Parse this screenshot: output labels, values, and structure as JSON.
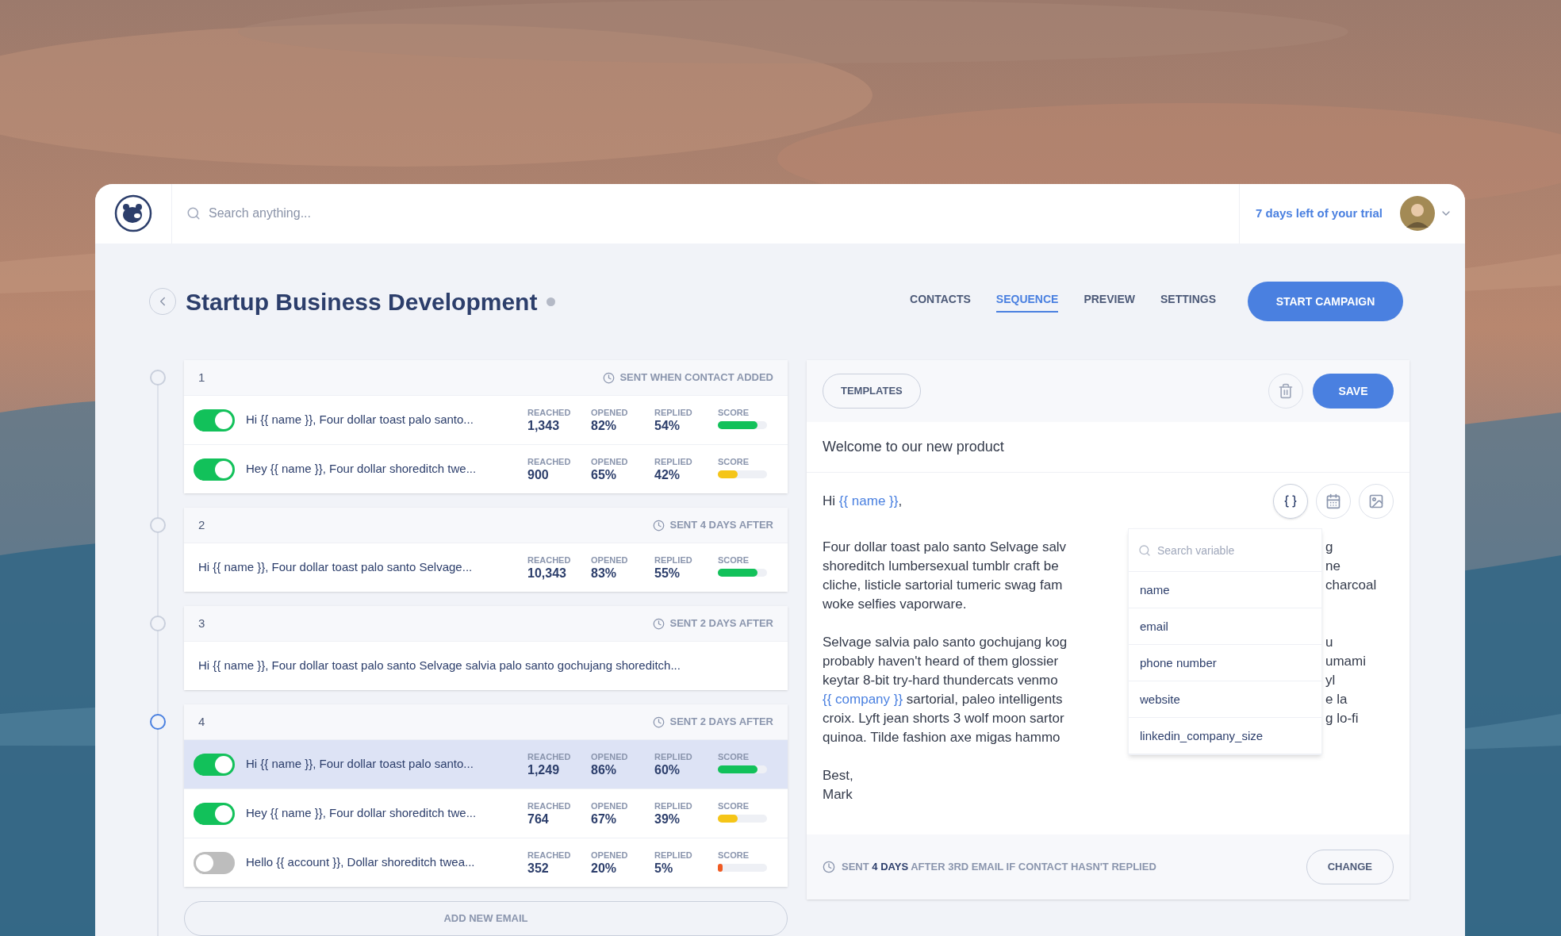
{
  "topbar": {
    "search_placeholder": "Search anything...",
    "trial": "7 days left of your trial"
  },
  "campaign": {
    "title": "Startup Business Development",
    "tabs": [
      {
        "label": "CONTACTS",
        "selected": false
      },
      {
        "label": "SEQUENCE",
        "selected": true
      },
      {
        "label": "PREVIEW",
        "selected": false
      },
      {
        "label": "SETTINGS",
        "selected": false
      }
    ],
    "start_button": "START CAMPAIGN"
  },
  "steps": [
    {
      "number": "1",
      "schedule": "SENT WHEN CONTACT ADDED",
      "selected": false,
      "emails": [
        {
          "kind": "toggle",
          "on": true,
          "selected": false,
          "preview": "Hi {{ name }}, Four dollar toast palo santo...",
          "stats": [
            {
              "label": "REACHED",
              "value": "1,343"
            },
            {
              "label": "OPENED",
              "value": "82%"
            },
            {
              "label": "REPLIED",
              "value": "54%"
            }
          ],
          "score_label": "SCORE",
          "level": 0.8,
          "color": "#12c15a"
        },
        {
          "kind": "toggle",
          "on": true,
          "selected": false,
          "preview": "Hey {{ name }}, Four dollar shoreditch twe...",
          "stats": [
            {
              "label": "REACHED",
              "value": "900"
            },
            {
              "label": "OPENED",
              "value": "65%"
            },
            {
              "label": "REPLIED",
              "value": "42%"
            }
          ],
          "score_label": "SCORE",
          "level": 0.4,
          "color": "#f5c518"
        }
      ]
    },
    {
      "number": "2",
      "schedule": "SENT 4 DAYS AFTER",
      "selected": false,
      "emails": [
        {
          "kind": "plain",
          "selected": false,
          "preview": "Hi {{ name }}, Four dollar toast  palo santo  Selvage...",
          "stats": [
            {
              "label": "REACHED",
              "value": "10,343"
            },
            {
              "label": "OPENED",
              "value": "83%"
            },
            {
              "label": "REPLIED",
              "value": "55%"
            }
          ],
          "score_label": "SCORE",
          "level": 0.8,
          "color": "#12c15a"
        }
      ]
    },
    {
      "number": "3",
      "schedule": "SENT 2 DAYS AFTER",
      "selected": false,
      "emails": [
        {
          "kind": "text",
          "selected": false,
          "preview": "Hi {{ name }}, Four dollar toast  palo santo  Selvage salvia palo santo gochujang shoreditch..."
        }
      ]
    },
    {
      "number": "4",
      "schedule": "SENT 2 DAYS AFTER",
      "selected": true,
      "emails": [
        {
          "kind": "toggle",
          "on": true,
          "selected": true,
          "preview": "Hi {{ name }}, Four dollar toast  palo santo...",
          "stats": [
            {
              "label": "REACHED",
              "value": "1,249"
            },
            {
              "label": "OPENED",
              "value": "86%"
            },
            {
              "label": "REPLIED",
              "value": "60%"
            }
          ],
          "score_label": "SCORE",
          "level": 0.8,
          "color": "#12c15a"
        },
        {
          "kind": "toggle",
          "on": true,
          "selected": false,
          "preview": "Hey {{ name }}, Four dollar shoreditch twe...",
          "stats": [
            {
              "label": "REACHED",
              "value": "764"
            },
            {
              "label": "OPENED",
              "value": "67%"
            },
            {
              "label": "REPLIED",
              "value": "39%"
            }
          ],
          "score_label": "SCORE",
          "level": 0.4,
          "color": "#f5c518"
        },
        {
          "kind": "toggle",
          "on": false,
          "selected": false,
          "preview": "Hello {{ account }}, Dollar shoreditch twea...",
          "stats": [
            {
              "label": "REACHED",
              "value": "352"
            },
            {
              "label": "OPENED",
              "value": "20%"
            },
            {
              "label": "REPLIED",
              "value": "5%"
            }
          ],
          "score_label": "SCORE",
          "level": 0.1,
          "color": "#f05a22"
        }
      ]
    }
  ],
  "add_email": "ADD NEW EMAIL",
  "editor": {
    "templates_button": "TEMPLATES",
    "save_button": "SAVE",
    "subject": "Welcome to our new product",
    "greeting": [
      {
        "text": "Hi ",
        "variable": false
      },
      {
        "text": "{{ name }}",
        "variable": true
      },
      {
        "text": ",",
        "variable": false
      }
    ],
    "paragraphs": [
      [
        {
          "left": [
            {
              "text": "Four dollar toast  palo santo Selvage salv",
              "variable": false
            }
          ],
          "right": "g"
        },
        {
          "left": [
            {
              "text": "shoreditch lumbersexual tumblr craft be",
              "variable": false
            }
          ],
          "right": "ne"
        },
        {
          "left": [
            {
              "text": "cliche, listicle sartorial tumeric swag fam",
              "variable": false
            }
          ],
          "right": "charcoal"
        },
        {
          "left": [
            {
              "text": "woke selfies vaporware.",
              "variable": false
            }
          ]
        }
      ],
      [
        {
          "left": [
            {
              "text": "Selvage salvia palo santo gochujang kog",
              "variable": false
            }
          ],
          "right": "u"
        },
        {
          "left": [
            {
              "text": "probably haven't heard of them glossier",
              "variable": false
            }
          ],
          "right": "umami"
        },
        {
          "left": [
            {
              "text": "keytar 8-bit try-hard thundercats venmo",
              "variable": false
            }
          ],
          "right": "yl"
        },
        {
          "left": [
            {
              "text": "{{ company }}",
              "variable": true
            },
            {
              "text": " sartorial, paleo intelligents",
              "variable": false
            }
          ],
          "right": "e la"
        },
        {
          "left": [
            {
              "text": "croix. Lyft jean shorts 3 wolf moon sartor",
              "variable": false
            }
          ],
          "right": "g lo-fi"
        },
        {
          "left": [
            {
              "text": "quinoa. Tilde fashion axe migas hammo",
              "variable": false
            }
          ]
        }
      ]
    ],
    "signoff": [
      "Best,",
      "Mark"
    ],
    "variable_menu": {
      "placeholder": "Search variable",
      "items": [
        "name",
        "email",
        "phone number",
        "website",
        "linkedin_company_size"
      ]
    },
    "footer": "SENT **4 DAYS** AFTER 3RD EMAIL IF CONTACT HASN'T REPLIED",
    "change_button": "CHANGE"
  }
}
